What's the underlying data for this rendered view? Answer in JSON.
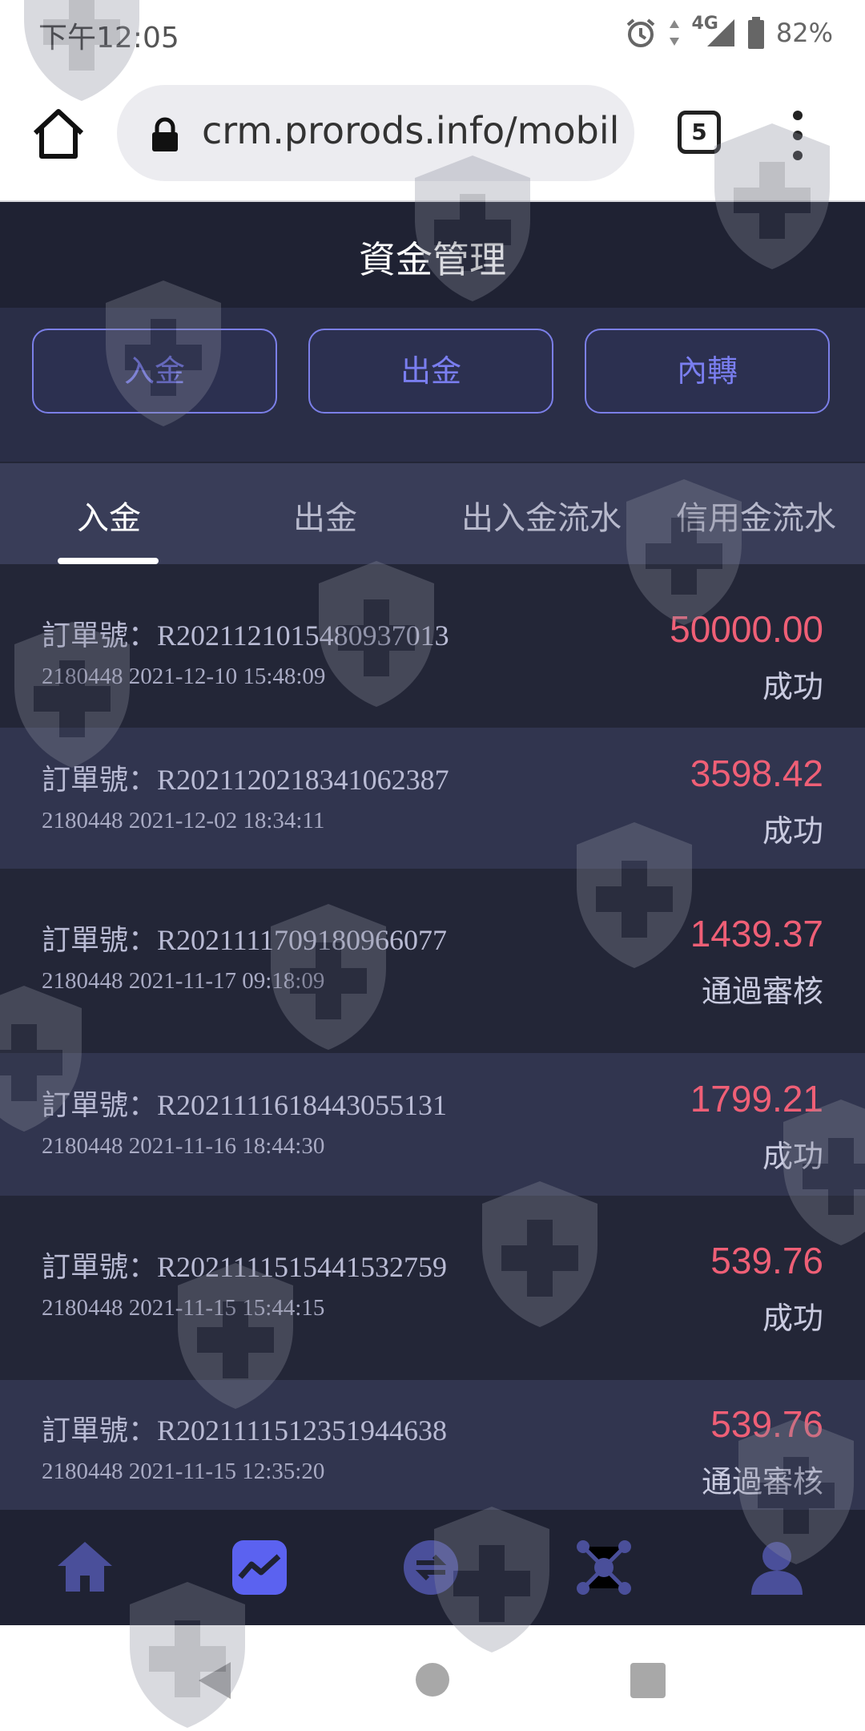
{
  "status_bar": {
    "time": "下午12:05",
    "network": "4G",
    "battery": "82%"
  },
  "browser": {
    "url": "crm.prorods.info/mobile",
    "tab_count": "5"
  },
  "page": {
    "title": "資金管理"
  },
  "actions": [
    {
      "label": "入金"
    },
    {
      "label": "出金"
    },
    {
      "label": "內轉"
    }
  ],
  "tabs": [
    {
      "label": "入金",
      "active": true
    },
    {
      "label": "出金",
      "active": false
    },
    {
      "label": "出入金流水",
      "active": false
    },
    {
      "label": "信用金流水",
      "active": false
    }
  ],
  "orders": [
    {
      "order_no": "訂單號：R2021121015480937013",
      "account": "2180448",
      "datetime": "2021-12-10 15:48:09",
      "amount": "50000.00",
      "status": "成功"
    },
    {
      "order_no": "訂單號：R2021120218341062387",
      "account": "2180448",
      "datetime": "2021-12-02 18:34:11",
      "amount": "3598.42",
      "status": "成功"
    },
    {
      "order_no": "訂單號：R2021111709180966077",
      "account": "2180448",
      "datetime": "2021-11-17 09:18:09",
      "amount": "1439.37",
      "status": "通過審核"
    },
    {
      "order_no": "訂單號：R2021111618443055131",
      "account": "2180448",
      "datetime": "2021-11-16 18:44:30",
      "amount": "1799.21",
      "status": "成功"
    },
    {
      "order_no": "訂單號：R2021111515441532759",
      "account": "2180448",
      "datetime": "2021-11-15 15:44:15",
      "amount": "539.76",
      "status": "成功"
    },
    {
      "order_no": "訂單號：R2021111512351944638",
      "account": "2180448",
      "datetime": "2021-11-15 12:35:20",
      "amount": "539.76",
      "status": "通過審核"
    }
  ],
  "bottom_nav": [
    {
      "icon": "home-icon"
    },
    {
      "icon": "chart-icon",
      "active": true
    },
    {
      "icon": "exchange-icon"
    },
    {
      "icon": "network-icon"
    },
    {
      "icon": "user-icon"
    }
  ],
  "colors": {
    "accent": "#5b62f0",
    "amount": "#ef5f76",
    "background": "#232637",
    "row_alt": "#31354f"
  }
}
